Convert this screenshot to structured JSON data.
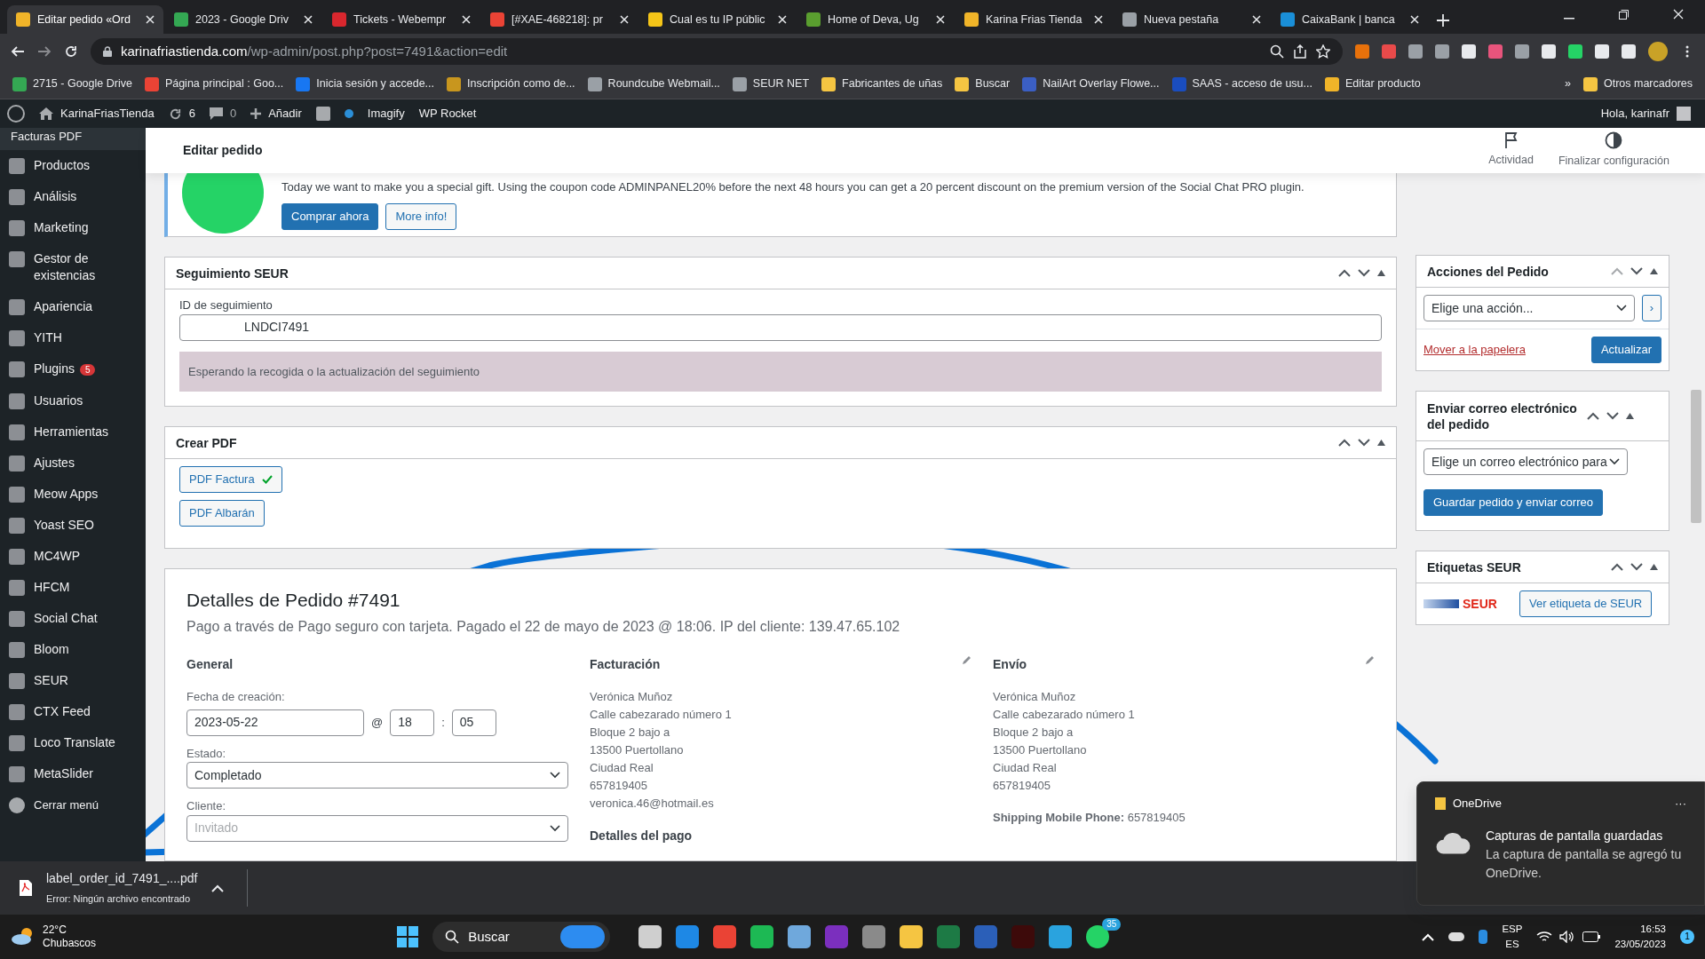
{
  "browser": {
    "tabs": [
      {
        "title": "Editar pedido «Ord",
        "selected": true,
        "color": "#f0b429"
      },
      {
        "title": "2023 - Google Driv",
        "selected": false,
        "color": "#34a853"
      },
      {
        "title": "Tickets - Webempr",
        "selected": false,
        "color": "#d9272e"
      },
      {
        "title": "[#XAE-468218]: pr",
        "selected": false,
        "color": "#ea4335"
      },
      {
        "title": "Cual es tu IP públic",
        "selected": false,
        "color": "#f5c518"
      },
      {
        "title": "Home of Deva, Ug",
        "selected": false,
        "color": "#5a9e2f"
      },
      {
        "title": "Karina Frias Tienda",
        "selected": false,
        "color": "#f0b429"
      },
      {
        "title": "Nueva pestaña",
        "selected": false,
        "color": "#9aa0a6"
      },
      {
        "title": "CaixaBank | banca",
        "selected": false,
        "color": "#1a8fd8"
      }
    ],
    "address_host": "karinafriastienda.com",
    "address_path": "/wp-admin/post.php?post=7491&action=edit",
    "bookmarks": [
      {
        "label": "2715 - Google Drive",
        "color": "#34a853"
      },
      {
        "label": "Página principal : Goo...",
        "color": "#ea4335"
      },
      {
        "label": "Inicia sesión y accede...",
        "color": "#1877f2"
      },
      {
        "label": "Inscripción como de...",
        "color": "#c8961e"
      },
      {
        "label": "Roundcube Webmail...",
        "color": "#9aa0a6"
      },
      {
        "label": "SEUR NET",
        "color": "#9aa0a6"
      },
      {
        "label": "Fabricantes de uñas",
        "color": "#f5c542"
      },
      {
        "label": "Buscar",
        "color": "#f5c542"
      },
      {
        "label": "NailArt Overlay Flowe...",
        "color": "#3b5fc4"
      },
      {
        "label": "SAAS - acceso de usu...",
        "color": "#1a4dbf"
      },
      {
        "label": "Editar producto",
        "color": "#f0b429"
      }
    ],
    "more": "»",
    "other_bookmarks": "Otros marcadores"
  },
  "admin_bar": {
    "site": "KarinaFriasTienda",
    "updates": "6",
    "comments": "0",
    "new": "Añadir",
    "items": [
      "Imagify",
      "WP Rocket"
    ],
    "greeting": "Hola, karinafr"
  },
  "sidebar": {
    "items": [
      {
        "label": "Facturas PDF",
        "kind": "submenu",
        "selected": false
      },
      {
        "label": "Productos",
        "kind": "menu",
        "selected": false
      },
      {
        "label": "Análisis",
        "kind": "menu",
        "selected": false
      },
      {
        "label": "Marketing",
        "kind": "menu",
        "selected": false
      },
      {
        "label": "Gestor de existencias",
        "kind": "menu",
        "selected": false
      },
      {
        "label": "Apariencia",
        "kind": "menu",
        "selected": false
      },
      {
        "label": "YITH",
        "kind": "menu",
        "selected": false
      },
      {
        "label": "Plugins",
        "kind": "menu",
        "selected": false,
        "badge": "5"
      },
      {
        "label": "Usuarios",
        "kind": "menu",
        "selected": false
      },
      {
        "label": "Herramientas",
        "kind": "menu",
        "selected": false
      },
      {
        "label": "Ajustes",
        "kind": "menu",
        "selected": false
      },
      {
        "label": "Meow Apps",
        "kind": "menu",
        "selected": false
      },
      {
        "label": "Yoast SEO",
        "kind": "menu",
        "selected": false
      },
      {
        "label": "MC4WP",
        "kind": "menu",
        "selected": false
      },
      {
        "label": "HFCM",
        "kind": "menu",
        "selected": false
      },
      {
        "label": "Social Chat",
        "kind": "menu",
        "selected": false
      },
      {
        "label": "Bloom",
        "kind": "menu",
        "selected": false
      },
      {
        "label": "SEUR",
        "kind": "menu",
        "selected": false
      },
      {
        "label": "CTX Feed",
        "kind": "menu",
        "selected": false
      },
      {
        "label": "Loco Translate",
        "kind": "menu",
        "selected": false
      },
      {
        "label": "MetaSlider",
        "kind": "menu",
        "selected": false
      },
      {
        "label": "Cerrar menú",
        "kind": "collapse",
        "selected": false
      }
    ]
  },
  "header": {
    "title": "Editar pedido",
    "actions": [
      "Actividad",
      "Finalizar configuración"
    ]
  },
  "promo": {
    "text": "Today we want to make you a special gift. Using the coupon code ADMINPANEL20% before the next 48 hours you can get a 20 percent discount on the premium version of the Social Chat PRO plugin.",
    "buttons": [
      "Comprar ahora",
      "More info!"
    ]
  },
  "tracking": {
    "title": "Seguimiento SEUR",
    "field_label": "ID de seguimiento",
    "value": "LNDCI7491",
    "notice": "Esperando la recogida o la actualización del seguimiento"
  },
  "pdf": {
    "title": "Crear PDF",
    "buttons": [
      {
        "label": "PDF Factura",
        "done": true
      },
      {
        "label": "PDF Albarán",
        "done": false
      }
    ]
  },
  "order": {
    "title": "Detalles de Pedido #7491",
    "subtitle": "Pago a través de Pago seguro con tarjeta. Pagado el 22 de mayo de 2023 @ 18:06. IP del cliente: 139.47.65.102",
    "general": {
      "heading": "General",
      "date_label": "Fecha de creación:",
      "date": "2023-05-22",
      "at": "@",
      "hour": "18",
      "sep": ":",
      "minute": "05",
      "status_label": "Estado:",
      "status": "Completado",
      "client_label": "Cliente:",
      "client_placeholder": "Invitado"
    },
    "billing": {
      "heading": "Facturación",
      "lines": [
        "Verónica Muñoz",
        "Calle cabezarado número 1",
        "Bloque 2 bajo a",
        "13500 Puertollano",
        "Ciudad Real",
        "657819405",
        "veronica.46@hotmail.es"
      ],
      "payment_heading": "Detalles del pago"
    },
    "shipping": {
      "heading": "Envío",
      "lines": [
        "Verónica Muñoz",
        "Calle cabezarado número 1",
        "Bloque 2 bajo a",
        "13500 Puertollano",
        "Ciudad Real",
        "657819405"
      ],
      "phone_label": "Shipping Mobile Phone:",
      "phone": "657819405"
    }
  },
  "side_panels": {
    "actions": {
      "title": "Acciones del Pedido",
      "select": "Elige una acción...",
      "go": "›",
      "trash": "Mover a la papelera",
      "update": "Actualizar"
    },
    "email": {
      "title": "Enviar correo electrónico del pedido",
      "select": "Elige un correo electrónico para",
      "button": "Guardar pedido y enviar correo"
    },
    "labels": {
      "title": "Etiquetas SEUR",
      "logo": "SEUR",
      "button": "Ver etiqueta de SEUR"
    }
  },
  "download": {
    "file": "label_order_id_7491_....pdf",
    "error": "Error: Ningún archivo encontrado"
  },
  "toast": {
    "app": "OneDrive",
    "more": "···",
    "title": "Capturas de pantalla guardadas",
    "body": "La captura de pantalla se agregó tu OneDrive."
  },
  "taskbar": {
    "temp": "22°C",
    "weather": "Chubascos",
    "search": "Buscar",
    "whatsapp_badge": "35",
    "lang": "ESP",
    "layout": "ES",
    "time": "16:53",
    "date": "23/05/2023",
    "notifications": "1"
  }
}
